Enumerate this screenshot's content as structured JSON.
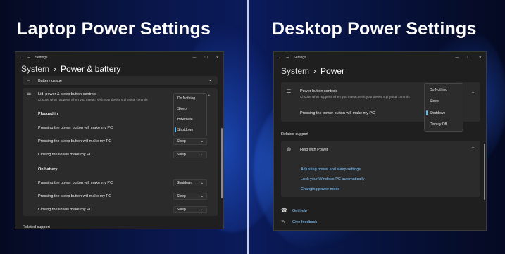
{
  "headings": {
    "left": "Laptop Power Settings",
    "right": "Desktop Power Settings"
  },
  "laptop": {
    "title": "Settings",
    "breadcrumb": {
      "parent": "System",
      "separator": "›",
      "current": "Power & battery"
    },
    "battery_usage": "Battery usage",
    "lid_title": "Lid, power & sleep button controls",
    "lid_desc": "Choose what happens when you interact with your device's physical controls",
    "plugged_in": "Plugged in",
    "on_battery": "On battery",
    "rows_plugged": [
      {
        "label": "Pressing the power button will make my PC"
      },
      {
        "label": "Pressing the sleep button will make my PC",
        "value": "Sleep"
      },
      {
        "label": "Closing the lid will make my PC",
        "value": "Sleep"
      }
    ],
    "rows_battery": [
      {
        "label": "Pressing the power button will make my PC",
        "value": "Shutdown"
      },
      {
        "label": "Pressing the sleep button will make my PC",
        "value": "Sleep"
      },
      {
        "label": "Closing the lid will make my PC",
        "value": "Sleep"
      }
    ],
    "menu": [
      "Do Nothing",
      "Sleep",
      "Hibernate",
      "Shutdown"
    ],
    "menu_selected": "Shutdown",
    "related": "Related support"
  },
  "desktop": {
    "title": "Settings",
    "breadcrumb": {
      "parent": "System",
      "separator": "›",
      "current": "Power"
    },
    "power_title": "Power button controls",
    "power_desc": "Choose what happens when you interact with your device's physical controls",
    "row_label": "Pressing the power button will make my PC",
    "menu": [
      "Do Nothing",
      "Sleep",
      "Shutdown",
      "Display Off"
    ],
    "menu_selected": "Shutdown",
    "related": "Related support",
    "help_title": "Help with Power",
    "links": [
      "Adjusting power and sleep settings",
      "Lock your Windows PC automatically",
      "Changing power mode"
    ],
    "get_help": "Get help",
    "feedback": "Give feedback"
  },
  "icons": {
    "back": "back-arrow-icon",
    "menu": "hamburger-icon",
    "minimize": "minimize-icon",
    "maximize": "maximize-icon",
    "close": "close-icon"
  },
  "colors": {
    "accent": "#4cc2ff",
    "link": "#7fc4ff",
    "window": "#1f1f1f",
    "card": "#2b2b2b"
  }
}
